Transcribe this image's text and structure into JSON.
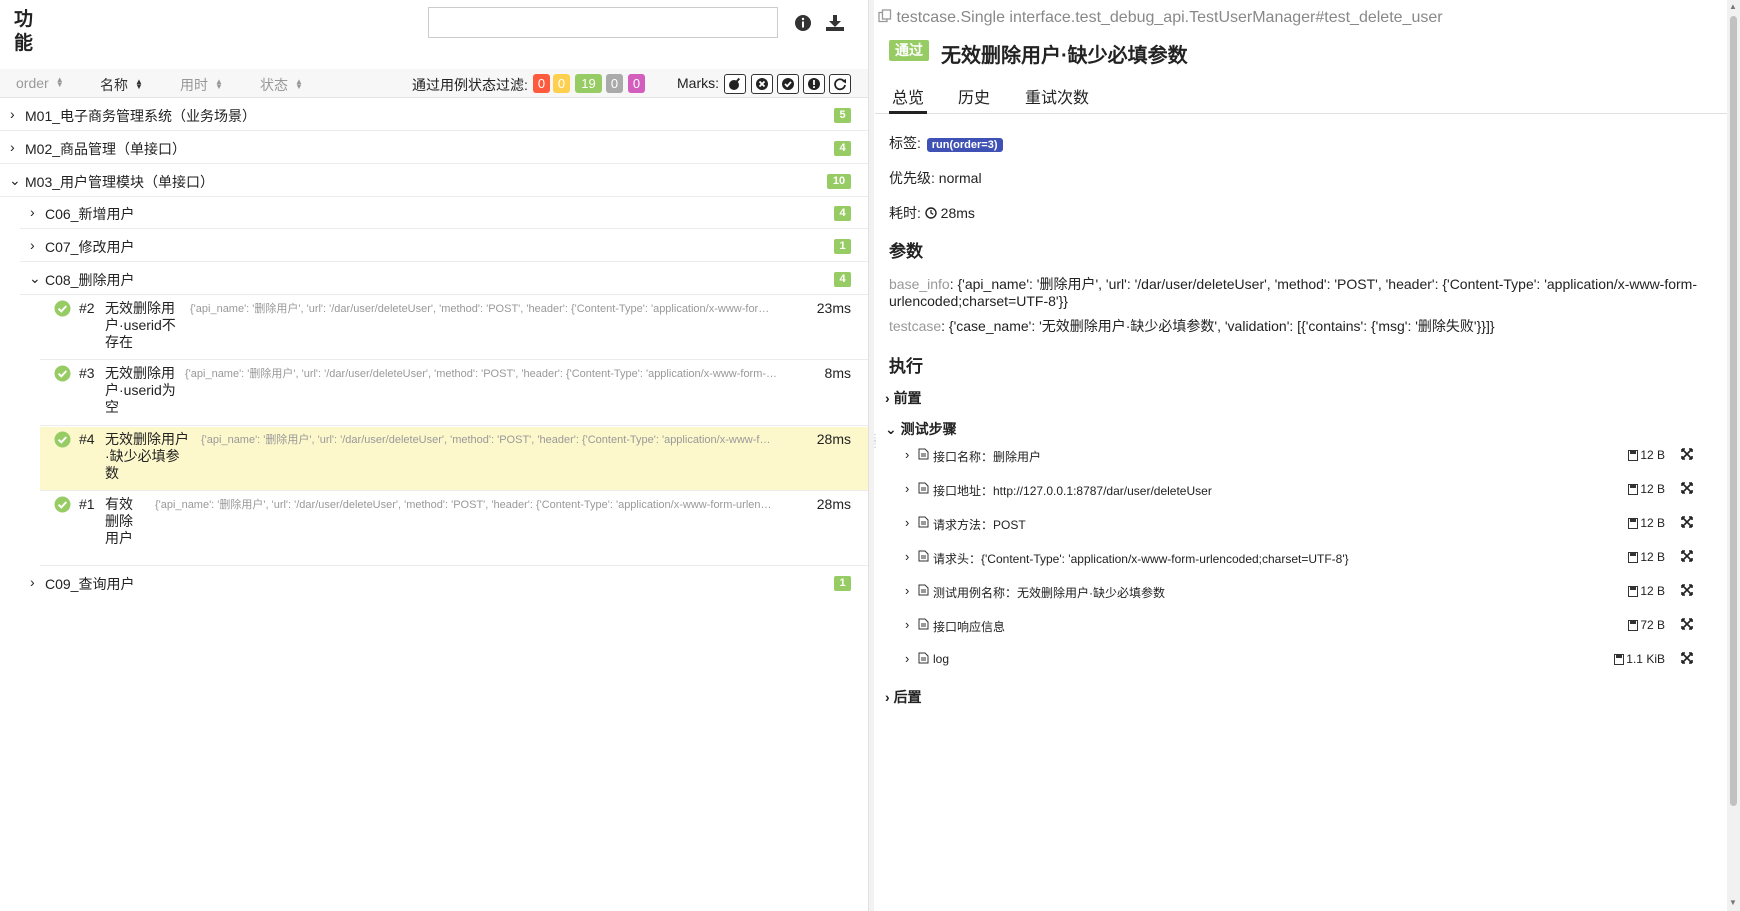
{
  "left": {
    "title": "功能",
    "search": {
      "value": "",
      "placeholder": ""
    },
    "sort_columns": [
      "order",
      "名称",
      "用时",
      "状态"
    ],
    "filter_label": "通过用例状态过滤:",
    "status_badges": [
      {
        "value": "0",
        "color": "#fd5a3e"
      },
      {
        "value": "0",
        "color": "#ffd050"
      },
      {
        "value": "19",
        "color": "#97cc64"
      },
      {
        "value": "0",
        "color": "#aaaaaa"
      },
      {
        "value": "0",
        "color": "#d35ebe"
      }
    ],
    "marks_label": "Marks:",
    "tree": {
      "m01": {
        "label": "M01_电子商务管理系统（业务场景）",
        "count": "5"
      },
      "m02": {
        "label": "M02_商品管理（单接口）",
        "count": "4"
      },
      "m03": {
        "label": "M03_用户管理模块（单接口）",
        "count": "10"
      },
      "c06": {
        "label": "C06_新增用户",
        "count": "4"
      },
      "c07": {
        "label": "C07_修改用户",
        "count": "1"
      },
      "c08": {
        "label": "C08_删除用户",
        "count": "4"
      },
      "c09": {
        "label": "C09_查询用户",
        "count": "1"
      },
      "cases": [
        {
          "num": "#2",
          "name": "无效删除用户·userid不存在",
          "params": "{'api_name': '删除用户', 'url': '/dar/user/deleteUser', 'method': 'POST', 'header': {'Content-Type': 'application/x-www-for…",
          "duration": "23ms"
        },
        {
          "num": "#3",
          "name": "无效删除用户·userid为空",
          "params": "{'api_name': '删除用户', 'url': '/dar/user/deleteUser', 'method': 'POST', 'header': {'Content-Type': 'application/x-www-form-…",
          "duration": "8ms"
        },
        {
          "num": "#4",
          "name": "无效删除用户·缺少必填参数",
          "params": "{'api_name': '删除用户', 'url': '/dar/user/deleteUser', 'method': 'POST', 'header': {'Content-Type': 'application/x-www-f…",
          "duration": "28ms"
        },
        {
          "num": "#1",
          "name": "有效删除用户",
          "params": "{'api_name': '删除用户', 'url': '/dar/user/deleteUser', 'method': 'POST', 'header': {'Content-Type': 'application/x-www-form-urlen…",
          "duration": "28ms"
        }
      ]
    }
  },
  "right": {
    "breadcrumb": "testcase.Single interface.test_debug_api.TestUserManager#test_delete_user",
    "status": "通过",
    "title": "无效删除用户·缺少必填参数",
    "tabs": [
      "总览",
      "历史",
      "重试次数"
    ],
    "tags_label": "标签:",
    "tag": "run(order=3)",
    "priority_label": "优先级:",
    "priority": "normal",
    "duration_label": "耗时:",
    "duration": "28ms",
    "params_heading": "参数",
    "params": [
      {
        "key": "base_info",
        "value": "{'api_name': '删除用户', 'url': '/dar/user/deleteUser', 'method': 'POST', 'header': {'Content-Type': 'application/x-www-form-urlencoded;charset=UTF-8'}}"
      },
      {
        "key": "testcase",
        "value": "{'case_name': '无效删除用户·缺少必填参数', 'validation': [{'contains': {'msg': '删除失败'}}]}"
      }
    ],
    "exec_heading": "执行",
    "setup": "前置",
    "steps_label": "测试步骤",
    "teardown": "后置",
    "steps": [
      {
        "label": "接口名称：删除用户",
        "size": "12 B"
      },
      {
        "label": "接口地址：http://127.0.0.1:8787/dar/user/deleteUser",
        "size": "12 B"
      },
      {
        "label": "请求方法：POST",
        "size": "12 B"
      },
      {
        "label": "请求头：{'Content-Type': 'application/x-www-form-urlencoded;charset=UTF-8'}",
        "size": "12 B"
      },
      {
        "label": "测试用例名称：无效删除用户·缺少必填参数",
        "size": "12 B"
      },
      {
        "label": "接口响应信息",
        "size": "72 B"
      },
      {
        "label": "log",
        "size": "1.1 KiB"
      }
    ]
  }
}
